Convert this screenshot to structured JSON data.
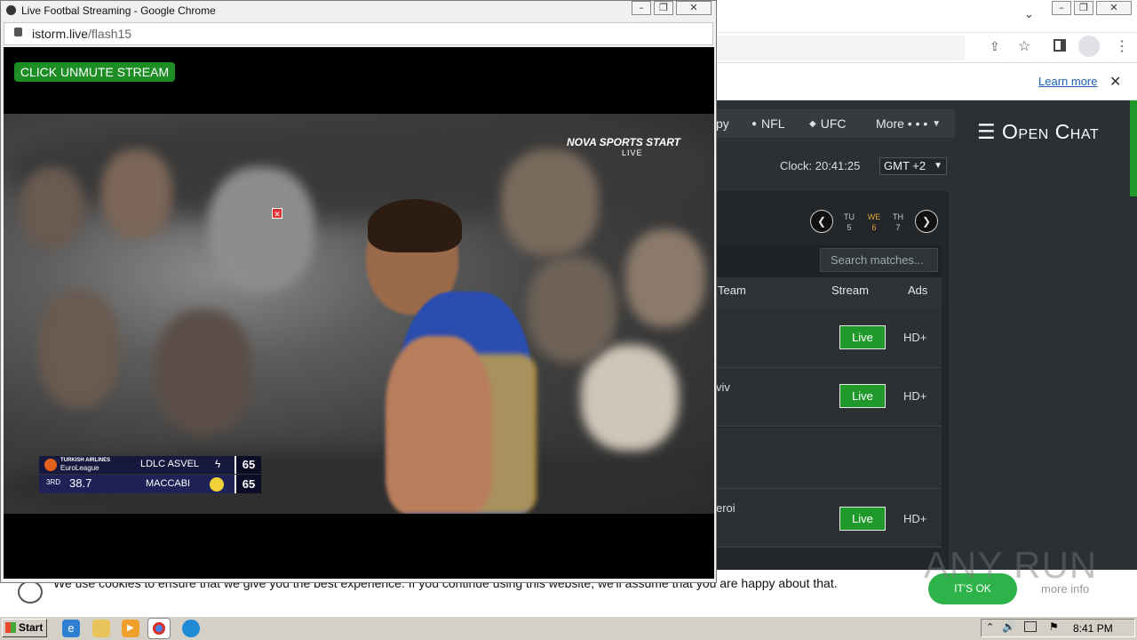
{
  "popup": {
    "title": "Live Footbal Streaming - Google Chrome",
    "url_domain": "istorm.live",
    "url_path": "/flash15",
    "unmute_label": "CLICK UNMUTE STREAM",
    "video": {
      "broadcaster": "NOVA SPORTS START",
      "live_tag": "LIVE",
      "scoreboard": {
        "sponsor": "TURKISH AIRLINES",
        "league": "EuroLeague",
        "period": "3RD",
        "game_clock": "38.7",
        "team1": "LDLC ASVEL",
        "score1": "65",
        "team2": "MACCABI",
        "score2": "65"
      }
    }
  },
  "background_browser": {
    "infobar_link": "Learn more",
    "infobar_close": "✕"
  },
  "site": {
    "nav": [
      {
        "label": "py",
        "icon": ""
      },
      {
        "label": "NFL",
        "icon": "football-icon"
      },
      {
        "label": "UFC",
        "icon": "glove-icon"
      },
      {
        "label": "More • • •",
        "icon": "caret-down-icon"
      }
    ],
    "open_chat": "☰ Open Chat",
    "clock": "Clock: 20:41:25",
    "timezone": "GMT +2",
    "days": [
      {
        "abbr": "TU",
        "num": "5",
        "active": false
      },
      {
        "abbr": "WE",
        "num": "6",
        "active": true
      },
      {
        "abbr": "TH",
        "num": "7",
        "active": false
      }
    ],
    "search_placeholder": "Search matches...",
    "table": {
      "headers": [
        "Team",
        "Stream",
        "Ads"
      ],
      "rows": [
        {
          "team": "",
          "stream": "Live",
          "ads": "HD+"
        },
        {
          "team": "viv",
          "stream": "Live",
          "ads": "HD+"
        },
        {
          "team": "",
          "stream": "",
          "ads": ""
        },
        {
          "team": "eroi",
          "stream": "Live",
          "ads": "HD+"
        }
      ]
    }
  },
  "cookie": {
    "text": "We use cookies to ensure that we give you the best experience. If you continue using this website, we'll assume that you are happy about that.",
    "ok_label": "IT'S OK",
    "more_label": "more info"
  },
  "taskbar": {
    "start_label": "Start",
    "time": "8:41 PM"
  },
  "watermark": "ANY RUN"
}
